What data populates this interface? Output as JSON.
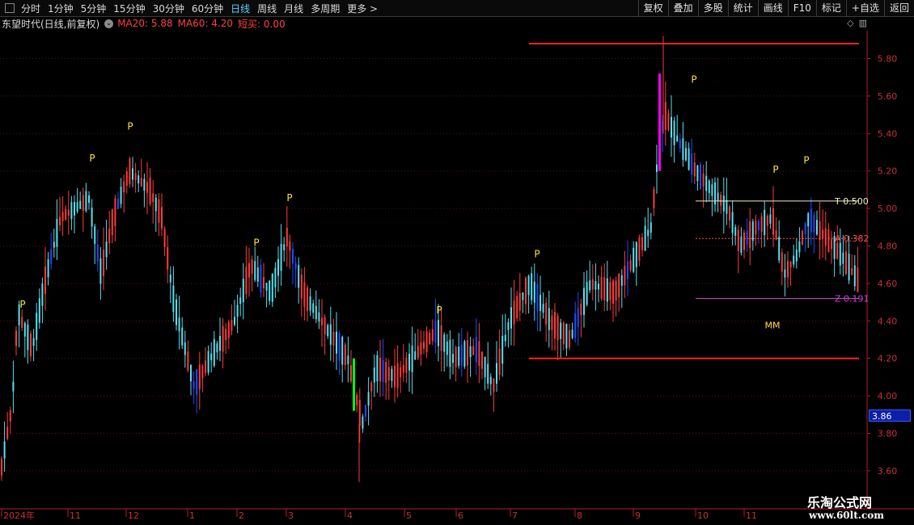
{
  "toolbar": {
    "periods": [
      "分时",
      "1分钟",
      "5分钟",
      "15分钟",
      "30分钟",
      "60分钟",
      "日线",
      "周线",
      "月线",
      "多周期",
      "更多 >"
    ],
    "active_index": 6,
    "right_buttons": [
      "复权",
      "叠加",
      "多股",
      "统计",
      "画线",
      "F10",
      "标记",
      "+自选",
      "返回"
    ]
  },
  "info_bar": {
    "stock": "东望时代(日线,前复权)",
    "circle_icon": "chevron-circle-icon",
    "ma20": "MA20: 5.88",
    "ma60": "MA60: 4.20",
    "short_buy": "短买: 0.00"
  },
  "colors": {
    "up": "#ff3a3a",
    "down": "#55e0f0",
    "blue_candle": "#1a4dff",
    "level_line": "#ff2020",
    "fib_top": "#f0f0c0",
    "fib_mid": "#ff5050",
    "fib_low": "#d040d0",
    "p_marker": "#ffe040",
    "green_bar": "#00ff00",
    "magenta_bar": "#ff00ff"
  },
  "chart_data": {
    "type": "candlestick",
    "y_ticks": [
      "5.80",
      "5.60",
      "5.40",
      "5.20",
      "5.00",
      "4.80",
      "4.60",
      "4.40",
      "4.20",
      "4.00",
      "3.80",
      "3.60"
    ],
    "y_values": [
      5.8,
      5.6,
      5.4,
      5.2,
      5.0,
      4.8,
      4.6,
      4.4,
      4.2,
      4.0,
      3.8,
      3.6
    ],
    "x_labels": [
      "2024年",
      "11",
      "12",
      "1",
      "2",
      "3",
      "4",
      "5",
      "6",
      "7",
      "8",
      "9",
      "10",
      "11"
    ],
    "current_price": "3.86",
    "resistance_level": 5.88,
    "support_level": 4.2,
    "fib_levels": [
      {
        "label": "T 0.500",
        "value": 5.04
      },
      {
        "label": "A 0.382",
        "value": 4.84
      },
      {
        "label": "Z 0.191",
        "value": 4.52
      }
    ],
    "markers": {
      "p_label": "P",
      "mm_label": "MM"
    }
  },
  "watermark": {
    "title": "乐淘公式网",
    "url": "www.60lt.com"
  }
}
